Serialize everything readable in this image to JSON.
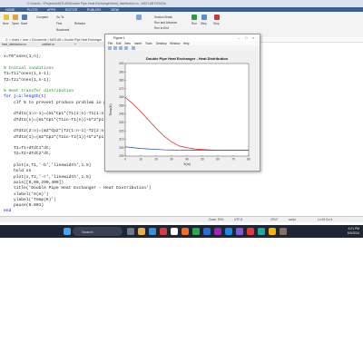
{
  "window": {
    "title": "C:\\Users\\...\\Projects\\MATLAB\\Double Pipe Heat Exchanger\\heat_distribution.m - MATLAB R2023a"
  },
  "ribbon_tabs": [
    "HOME",
    "PLOTS",
    "APPS",
    "EDITOR",
    "PUBLISH",
    "VIEW"
  ],
  "ribbon": {
    "new_label": "New",
    "open_label": "Open",
    "save_label": "Save",
    "compare_label": "Compare",
    "goto_label": "Go To",
    "find_label": "Find",
    "bookmark_label": "Bookmark",
    "refactor_label": "Refactor",
    "section_break": "Section Break",
    "run_advance": "Run and Advance",
    "run_to_end": "Run to End",
    "run_label": "Run",
    "step_label": "Step",
    "stop_label": "Stop"
  },
  "address": "C: > Users > User > Documents > MATLAB > Double Pipe Heat Exchanger",
  "file_tabs": [
    "heat_distribution.m",
    "untitled.m",
    "+"
  ],
  "code_lines": [
    {
      "text": "",
      "cls": ""
    },
    {
      "text": "x=T0*ones(1,n);",
      "cls": ""
    },
    {
      "text": "",
      "cls": ""
    },
    {
      "text": "% Initial conditions",
      "cls": "cm"
    },
    {
      "text": "T1=T1i*ones(1,n-1);",
      "cls": ""
    },
    {
      "text": "T2=T2i*ones(1,n-1);",
      "cls": ""
    },
    {
      "text": "",
      "cls": ""
    },
    {
      "text": "% Heat transfer distribution",
      "cls": "cm"
    },
    {
      "text": "for j=1:length(t)",
      "cls": "kw"
    },
    {
      "text": "    clf % to prevent produce problem in pl",
      "cls": "mix"
    },
    {
      "text": "",
      "cls": ""
    },
    {
      "text": "    dTdt1(1:n-1)=(m1*Cp1*(T1(2:n)-T1(1:n-1",
      "cls": ""
    },
    {
      "text": "    dTdt1(n)=(m1*Cp1*(T1in-T1(n))+U*2*pi*",
      "cls": ""
    },
    {
      "text": "",
      "cls": ""
    },
    {
      "text": "    dTdt2(2:n)=(m2*Cp2*(T2(1:n-1)-T2(2:n)",
      "cls": ""
    },
    {
      "text": "    dTdt2(1)=(m2*Cp2*(T2in-T2(1))+U*2*pi*r",
      "cls": ""
    },
    {
      "text": "",
      "cls": ""
    },
    {
      "text": "    T1=T1+dTdt1*dt;",
      "cls": ""
    },
    {
      "text": "    T2=T2+dTdt2*dt;",
      "cls": ""
    },
    {
      "text": "",
      "cls": ""
    },
    {
      "text": "    plot(x,T1,'-b','linewidth',1.5)",
      "cls": "plotb"
    },
    {
      "text": "    hold on",
      "cls": ""
    },
    {
      "text": "    plot(x,T2,'-r','linewidth',1.5)",
      "cls": "plotr"
    },
    {
      "text": "    axis([0,80,290,400])",
      "cls": ""
    },
    {
      "text": "    title('Double Pipe Heat Exchanger - Heat Distribution')",
      "cls": "title"
    },
    {
      "text": "    xlabel('X(m)')",
      "cls": "xl"
    },
    {
      "text": "    ylabel('Temp(K)')",
      "cls": "yl"
    },
    {
      "text": "    pause(0.001)",
      "cls": ""
    },
    {
      "text": "end",
      "cls": "kw"
    }
  ],
  "status": {
    "zoom": "Zoom: 90%",
    "encoding": "UTF-8",
    "line_ending": "CRLF",
    "script": "script",
    "position": "Ln 28  Col 4"
  },
  "figure": {
    "window_title": "Figure 1",
    "menu": [
      "File",
      "Edit",
      "View",
      "Insert",
      "Tools",
      "Desktop",
      "Window",
      "Help"
    ]
  },
  "chart_data": {
    "type": "line",
    "title": "Double Pipe Heat Exchanger - Heat Distribution",
    "xlabel": "X(m)",
    "ylabel": "Temp(K)",
    "xlim": [
      0,
      80
    ],
    "ylim": [
      290,
      400
    ],
    "xticks": [
      0,
      10,
      20,
      30,
      40,
      50,
      60,
      70,
      80
    ],
    "yticks": [
      290,
      300,
      310,
      320,
      330,
      340,
      350,
      360,
      370,
      380,
      390,
      400
    ],
    "grid": false,
    "series": [
      {
        "color": "#1f3fbf",
        "x": [
          0,
          5,
          10,
          15,
          20,
          25,
          30,
          35,
          40,
          50,
          60,
          70,
          80
        ],
        "y": [
          301,
          300,
          299,
          298.5,
          298,
          297.5,
          297.3,
          297.1,
          297,
          297,
          297,
          297,
          297
        ]
      },
      {
        "color": "#d62020",
        "x": [
          0,
          5,
          10,
          15,
          20,
          25,
          30,
          35,
          40,
          45,
          50,
          55,
          60,
          70,
          80
        ],
        "y": [
          360,
          352,
          343,
          333,
          323,
          314,
          307,
          302,
          300,
          298.5,
          297.8,
          297.3,
          297,
          297,
          297
        ]
      }
    ]
  },
  "taskbar": {
    "search_label": "Search",
    "time": "4:21 PM",
    "date": "5/9/2024",
    "lang": "ENG"
  }
}
